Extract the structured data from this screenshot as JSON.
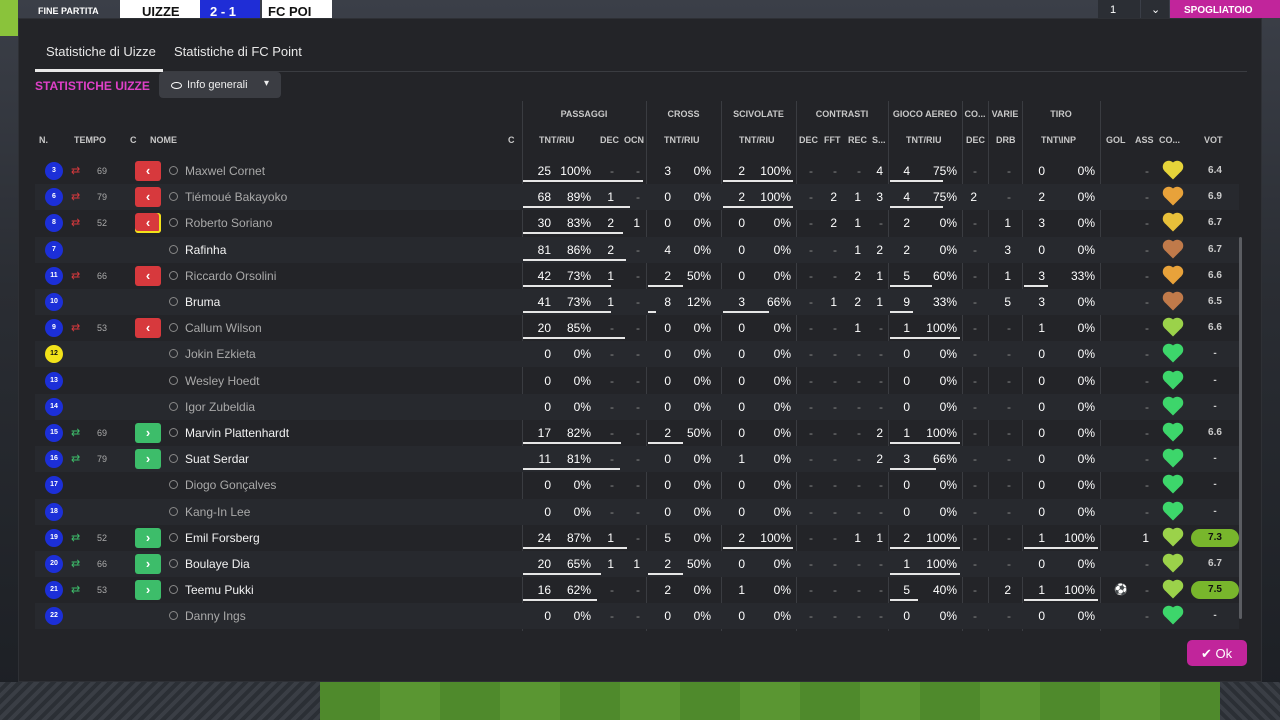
{
  "topbar": {
    "status": "FINE PARTITA",
    "team_home": "UIZZE",
    "score": "2 - 1",
    "team_away": "FC POI",
    "right_label": "SPOGLIATOIO",
    "count": "1"
  },
  "tabs": [
    "Statistiche di Uizze",
    "Statistiche di FC Point"
  ],
  "section_title": "STATISTICHE UIZZE",
  "filter_label": "Info generali",
  "groups": [
    "PASSAGGI",
    "CROSS",
    "SCIVOLATE",
    "CONTRASTI",
    "GIOCO AEREO",
    "CO...",
    "VARIE",
    "TIRO"
  ],
  "headers": {
    "n": "N.",
    "tempo": "TEMPO",
    "c": "C",
    "nome": "NOME",
    "c2": "C",
    "pass_tnt": "TNT/RIU",
    "pass_dec": "DEC",
    "pass_ocn": "OCN",
    "cross_tnt": "TNT/RIU",
    "sciv_tnt": "TNT/RIU",
    "con_dec": "DEC",
    "con_fft": "FFT",
    "con_rec": "REC",
    "con_s": "S...",
    "aereo_tnt": "TNT/RIU",
    "co_dec": "DEC",
    "varie_drb": "DRB",
    "tiro_tnt": "TNT\\INP",
    "gol": "GOL",
    "ass": "ASS",
    "cond": "CO...",
    "vot": "VOT"
  },
  "colors": {
    "accent": "#e040c8",
    "sub_out": "#d7393d",
    "sub_in": "#3dbd6a",
    "good_vote": "#78b62c",
    "kit": "#1c2fd8"
  },
  "players": [
    {
      "n": "3",
      "sub": "out",
      "min": "69",
      "c": "out",
      "name": "Maxwel Cornet",
      "dim": true,
      "p1": "25",
      "p2": "100%",
      "pb": 1.0,
      "pd": "-",
      "po": "-",
      "c1": "3",
      "c2": "0%",
      "cb": 0,
      "s1": "2",
      "s2": "100%",
      "sb": 1.0,
      "k1": "-",
      "k2": "-",
      "k3": "-",
      "k4": "4",
      "a1": "4",
      "a2": "75%",
      "ab": 0.75,
      "cd": "-",
      "dr": "-",
      "t1": "0",
      "t2": "0%",
      "tb": 0,
      "gol": "",
      "ass": "-",
      "heart": "#e6d43a",
      "vot": "6.4",
      "vg": false
    },
    {
      "n": "6",
      "sub": "out",
      "min": "79",
      "c": "out",
      "name": "Tiémoué Bakayoko",
      "dim": true,
      "p1": "68",
      "p2": "89%",
      "pb": 0.89,
      "pd": "1",
      "po": "-",
      "c1": "0",
      "c2": "0%",
      "cb": 0,
      "s1": "2",
      "s2": "100%",
      "sb": 1.0,
      "k1": "-",
      "k2": "2",
      "k3": "1",
      "k4": "3",
      "a1": "4",
      "a2": "75%",
      "ab": 0.75,
      "cd": "2",
      "dr": "-",
      "t1": "2",
      "t2": "0%",
      "tb": 0,
      "gol": "",
      "ass": "-",
      "heart": "#e8a23a",
      "vot": "6.9",
      "vg": false
    },
    {
      "n": "8",
      "sub": "out",
      "min": "52",
      "c": "out",
      "cap": true,
      "name": "Roberto Soriano",
      "dim": true,
      "p1": "30",
      "p2": "83%",
      "pb": 0.83,
      "pd": "2",
      "po": "1",
      "c1": "0",
      "c2": "0%",
      "cb": 0,
      "s1": "0",
      "s2": "0%",
      "sb": 0,
      "k1": "-",
      "k2": "2",
      "k3": "1",
      "k4": "-",
      "a1": "2",
      "a2": "0%",
      "ab": 0,
      "cd": "-",
      "dr": "1",
      "t1": "3",
      "t2": "0%",
      "tb": 0,
      "gol": "",
      "ass": "-",
      "heart": "#e8c03a",
      "vot": "6.7",
      "vg": false
    },
    {
      "n": "7",
      "sub": "",
      "min": "",
      "c": "",
      "name": "Rafinha",
      "dim": false,
      "p1": "81",
      "p2": "86%",
      "pb": 0.86,
      "pd": "2",
      "po": "-",
      "c1": "4",
      "c2": "0%",
      "cb": 0,
      "s1": "0",
      "s2": "0%",
      "sb": 0,
      "k1": "-",
      "k2": "-",
      "k3": "1",
      "k4": "2",
      "a1": "2",
      "a2": "0%",
      "ab": 0,
      "cd": "-",
      "dr": "3",
      "t1": "0",
      "t2": "0%",
      "tb": 0,
      "gol": "",
      "ass": "-",
      "heart": "#c07a4a",
      "vot": "6.7",
      "vg": false
    },
    {
      "n": "11",
      "sub": "out",
      "min": "66",
      "c": "out",
      "name": "Riccardo Orsolini",
      "dim": true,
      "p1": "42",
      "p2": "73%",
      "pb": 0.73,
      "pd": "1",
      "po": "-",
      "c1": "2",
      "c2": "50%",
      "cb": 0.5,
      "s1": "0",
      "s2": "0%",
      "sb": 0,
      "k1": "-",
      "k2": "-",
      "k3": "2",
      "k4": "1",
      "a1": "5",
      "a2": "60%",
      "ab": 0.6,
      "cd": "-",
      "dr": "1",
      "t1": "3",
      "t2": "33%",
      "tb": 0.33,
      "gol": "",
      "ass": "-",
      "heart": "#e8a23a",
      "vot": "6.6",
      "vg": false
    },
    {
      "n": "10",
      "sub": "",
      "min": "",
      "c": "",
      "name": "Bruma",
      "dim": false,
      "p1": "41",
      "p2": "73%",
      "pb": 0.73,
      "pd": "1",
      "po": "-",
      "c1": "8",
      "c2": "12%",
      "cb": 0.12,
      "s1": "3",
      "s2": "66%",
      "sb": 0.66,
      "k1": "-",
      "k2": "1",
      "k3": "2",
      "k4": "1",
      "a1": "9",
      "a2": "33%",
      "ab": 0.33,
      "cd": "-",
      "dr": "5",
      "t1": "3",
      "t2": "0%",
      "tb": 0,
      "gol": "",
      "ass": "-",
      "heart": "#c07a4a",
      "vot": "6.5",
      "vg": false
    },
    {
      "n": "9",
      "sub": "out",
      "min": "53",
      "c": "out",
      "name": "Callum Wilson",
      "dim": true,
      "p1": "20",
      "p2": "85%",
      "pb": 0.85,
      "pd": "-",
      "po": "-",
      "c1": "0",
      "c2": "0%",
      "cb": 0,
      "s1": "0",
      "s2": "0%",
      "sb": 0,
      "k1": "-",
      "k2": "-",
      "k3": "1",
      "k4": "-",
      "a1": "1",
      "a2": "100%",
      "ab": 1.0,
      "cd": "-",
      "dr": "-",
      "t1": "1",
      "t2": "0%",
      "tb": 0,
      "gol": "",
      "ass": "-",
      "heart": "#9bd24a",
      "vot": "6.6",
      "vg": false
    },
    {
      "n": "12",
      "gk": true,
      "sub": "",
      "min": "",
      "c": "",
      "name": "Jokin Ezkieta",
      "dim": true,
      "p1": "0",
      "p2": "0%",
      "pb": 0,
      "pd": "-",
      "po": "-",
      "c1": "0",
      "c2": "0%",
      "cb": 0,
      "s1": "0",
      "s2": "0%",
      "sb": 0,
      "k1": "-",
      "k2": "-",
      "k3": "-",
      "k4": "-",
      "a1": "0",
      "a2": "0%",
      "ab": 0,
      "cd": "-",
      "dr": "-",
      "t1": "0",
      "t2": "0%",
      "tb": 0,
      "gol": "",
      "ass": "-",
      "heart": "#3dd66b",
      "vot": "-",
      "vg": false
    },
    {
      "n": "13",
      "sub": "",
      "min": "",
      "c": "",
      "name": "Wesley Hoedt",
      "dim": true,
      "p1": "0",
      "p2": "0%",
      "pb": 0,
      "pd": "-",
      "po": "-",
      "c1": "0",
      "c2": "0%",
      "cb": 0,
      "s1": "0",
      "s2": "0%",
      "sb": 0,
      "k1": "-",
      "k2": "-",
      "k3": "-",
      "k4": "-",
      "a1": "0",
      "a2": "0%",
      "ab": 0,
      "cd": "-",
      "dr": "-",
      "t1": "0",
      "t2": "0%",
      "tb": 0,
      "gol": "",
      "ass": "-",
      "heart": "#3dd66b",
      "vot": "-",
      "vg": false
    },
    {
      "n": "14",
      "sub": "",
      "min": "",
      "c": "",
      "name": "Igor Zubeldia",
      "dim": true,
      "p1": "0",
      "p2": "0%",
      "pb": 0,
      "pd": "-",
      "po": "-",
      "c1": "0",
      "c2": "0%",
      "cb": 0,
      "s1": "0",
      "s2": "0%",
      "sb": 0,
      "k1": "-",
      "k2": "-",
      "k3": "-",
      "k4": "-",
      "a1": "0",
      "a2": "0%",
      "ab": 0,
      "cd": "-",
      "dr": "-",
      "t1": "0",
      "t2": "0%",
      "tb": 0,
      "gol": "",
      "ass": "-",
      "heart": "#3dd66b",
      "vot": "-",
      "vg": false
    },
    {
      "n": "15",
      "sub": "in",
      "min": "69",
      "c": "in",
      "name": "Marvin Plattenhardt",
      "dim": false,
      "p1": "17",
      "p2": "82%",
      "pb": 0.82,
      "pd": "-",
      "po": "-",
      "c1": "2",
      "c2": "50%",
      "cb": 0.5,
      "s1": "0",
      "s2": "0%",
      "sb": 0,
      "k1": "-",
      "k2": "-",
      "k3": "-",
      "k4": "2",
      "a1": "1",
      "a2": "100%",
      "ab": 1.0,
      "cd": "-",
      "dr": "-",
      "t1": "0",
      "t2": "0%",
      "tb": 0,
      "gol": "",
      "ass": "-",
      "heart": "#3dd66b",
      "vot": "6.6",
      "vg": false
    },
    {
      "n": "16",
      "sub": "in",
      "min": "79",
      "c": "in",
      "name": "Suat Serdar",
      "dim": false,
      "p1": "11",
      "p2": "81%",
      "pb": 0.81,
      "pd": "-",
      "po": "-",
      "c1": "0",
      "c2": "0%",
      "cb": 0,
      "s1": "1",
      "s2": "0%",
      "sb": 0,
      "k1": "-",
      "k2": "-",
      "k3": "-",
      "k4": "2",
      "a1": "3",
      "a2": "66%",
      "ab": 0.66,
      "cd": "-",
      "dr": "-",
      "t1": "0",
      "t2": "0%",
      "tb": 0,
      "gol": "",
      "ass": "-",
      "heart": "#3dd66b",
      "vot": "-",
      "vg": false
    },
    {
      "n": "17",
      "sub": "",
      "min": "",
      "c": "",
      "name": "Diogo Gonçalves",
      "dim": true,
      "p1": "0",
      "p2": "0%",
      "pb": 0,
      "pd": "-",
      "po": "-",
      "c1": "0",
      "c2": "0%",
      "cb": 0,
      "s1": "0",
      "s2": "0%",
      "sb": 0,
      "k1": "-",
      "k2": "-",
      "k3": "-",
      "k4": "-",
      "a1": "0",
      "a2": "0%",
      "ab": 0,
      "cd": "-",
      "dr": "-",
      "t1": "0",
      "t2": "0%",
      "tb": 0,
      "gol": "",
      "ass": "-",
      "heart": "#3dd66b",
      "vot": "-",
      "vg": false
    },
    {
      "n": "18",
      "sub": "",
      "min": "",
      "c": "",
      "name": "Kang-In Lee",
      "dim": true,
      "p1": "0",
      "p2": "0%",
      "pb": 0,
      "pd": "-",
      "po": "-",
      "c1": "0",
      "c2": "0%",
      "cb": 0,
      "s1": "0",
      "s2": "0%",
      "sb": 0,
      "k1": "-",
      "k2": "-",
      "k3": "-",
      "k4": "-",
      "a1": "0",
      "a2": "0%",
      "ab": 0,
      "cd": "-",
      "dr": "-",
      "t1": "0",
      "t2": "0%",
      "tb": 0,
      "gol": "",
      "ass": "-",
      "heart": "#3dd66b",
      "vot": "-",
      "vg": false
    },
    {
      "n": "19",
      "sub": "in",
      "min": "52",
      "c": "in",
      "name": "Emil Forsberg",
      "dim": false,
      "p1": "24",
      "p2": "87%",
      "pb": 0.87,
      "pd": "1",
      "po": "-",
      "c1": "5",
      "c2": "0%",
      "cb": 0,
      "s1": "2",
      "s2": "100%",
      "sb": 1.0,
      "k1": "-",
      "k2": "-",
      "k3": "1",
      "k4": "1",
      "a1": "2",
      "a2": "100%",
      "ab": 1.0,
      "cd": "-",
      "dr": "-",
      "t1": "1",
      "t2": "100%",
      "tb": 1.0,
      "gol": "",
      "ass": "1",
      "heart": "#9bd24a",
      "vot": "7.3",
      "vg": true
    },
    {
      "n": "20",
      "sub": "in",
      "min": "66",
      "c": "in",
      "name": "Boulaye Dia",
      "dim": false,
      "p1": "20",
      "p2": "65%",
      "pb": 0.65,
      "pd": "1",
      "po": "1",
      "c1": "2",
      "c2": "50%",
      "cb": 0.5,
      "s1": "0",
      "s2": "0%",
      "sb": 0,
      "k1": "-",
      "k2": "-",
      "k3": "-",
      "k4": "-",
      "a1": "1",
      "a2": "100%",
      "ab": 1.0,
      "cd": "-",
      "dr": "-",
      "t1": "0",
      "t2": "0%",
      "tb": 0,
      "gol": "",
      "ass": "-",
      "heart": "#9bd24a",
      "vot": "6.7",
      "vg": false
    },
    {
      "n": "21",
      "sub": "in",
      "min": "53",
      "c": "in",
      "name": "Teemu Pukki",
      "dim": false,
      "p1": "16",
      "p2": "62%",
      "pb": 0.62,
      "pd": "-",
      "po": "-",
      "c1": "2",
      "c2": "0%",
      "cb": 0,
      "s1": "1",
      "s2": "0%",
      "sb": 0,
      "k1": "-",
      "k2": "-",
      "k3": "-",
      "k4": "-",
      "a1": "5",
      "a2": "40%",
      "ab": 0.4,
      "cd": "-",
      "dr": "2",
      "t1": "1",
      "t2": "100%",
      "tb": 1.0,
      "gol": "ball",
      "ass": "-",
      "heart": "#9bd24a",
      "vot": "7.5",
      "vg": true
    },
    {
      "n": "22",
      "sub": "",
      "min": "",
      "c": "",
      "name": "Danny Ings",
      "dim": true,
      "p1": "0",
      "p2": "0%",
      "pb": 0,
      "pd": "-",
      "po": "-",
      "c1": "0",
      "c2": "0%",
      "cb": 0,
      "s1": "0",
      "s2": "0%",
      "sb": 0,
      "k1": "-",
      "k2": "-",
      "k3": "-",
      "k4": "-",
      "a1": "0",
      "a2": "0%",
      "ab": 0,
      "cd": "-",
      "dr": "-",
      "t1": "0",
      "t2": "0%",
      "tb": 0,
      "gol": "",
      "ass": "-",
      "heart": "#3dd66b",
      "vot": "-",
      "vg": false
    }
  ],
  "ok_label": "Ok"
}
